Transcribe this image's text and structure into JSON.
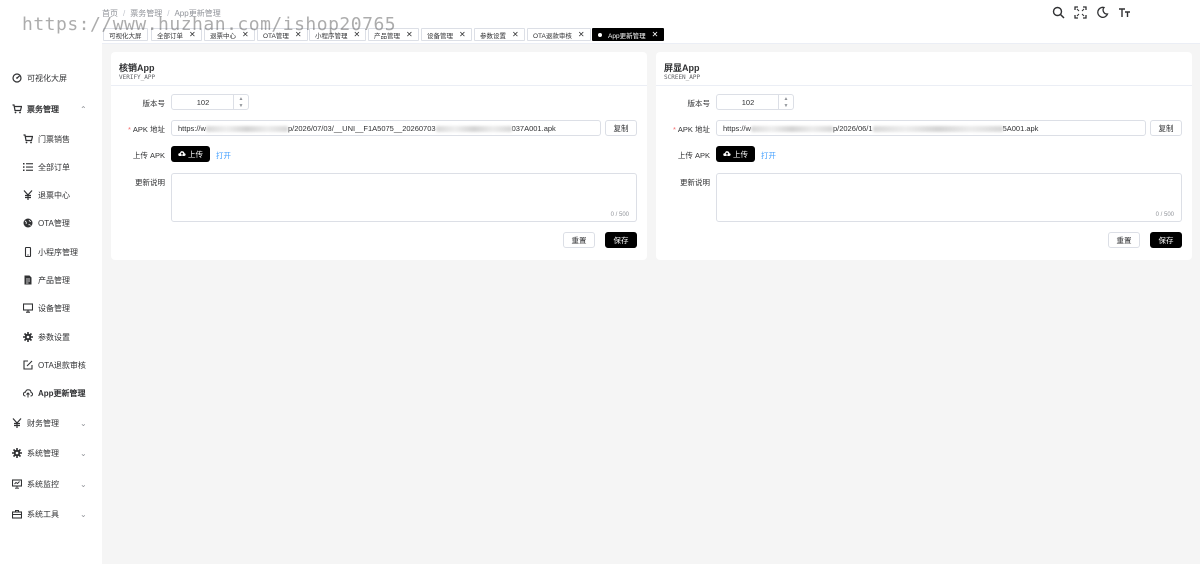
{
  "watermark": "https://www.huzhan.com/ishop20765",
  "breadcrumb": [
    "首页",
    "票务管理",
    "App更新管理"
  ],
  "header_icons": [
    "search-icon",
    "fullscreen-icon",
    "dark-mode-icon",
    "font-size-icon"
  ],
  "sidebar": {
    "items": [
      {
        "label": "可视化大屏",
        "icon": "dashboard-icon"
      },
      {
        "label": "票务管理",
        "icon": "cart-icon",
        "chevron": "⌃"
      },
      {
        "label": "门票销售",
        "icon": "cart-icon"
      },
      {
        "label": "全部订单",
        "icon": "list-icon"
      },
      {
        "label": "退票中心",
        "icon": "yen-icon"
      },
      {
        "label": "OTA管理",
        "icon": "globe-icon"
      },
      {
        "label": "小程序管理",
        "icon": "mobile-icon"
      },
      {
        "label": "产品管理",
        "icon": "document-icon"
      },
      {
        "label": "设备管理",
        "icon": "monitor-icon"
      },
      {
        "label": "参数设置",
        "icon": "gear-icon"
      },
      {
        "label": "OTA退款审核",
        "icon": "edit-icon"
      },
      {
        "label": "App更新管理",
        "icon": "cloud-upload-icon"
      },
      {
        "label": "财务管理",
        "icon": "yen-icon",
        "chevron": "⌄"
      },
      {
        "label": "系统管理",
        "icon": "gear-icon",
        "chevron": "⌄"
      },
      {
        "label": "系统监控",
        "icon": "monitor-icon",
        "chevron": "⌄"
      },
      {
        "label": "系统工具",
        "icon": "toolbox-icon",
        "chevron": "⌄"
      }
    ]
  },
  "tabs": [
    {
      "label": "可视化大屏",
      "close": ""
    },
    {
      "label": "全部订单",
      "close": "✕"
    },
    {
      "label": "退票中心",
      "close": "✕"
    },
    {
      "label": "OTA管理",
      "close": "✕"
    },
    {
      "label": "小程序管理",
      "close": "✕"
    },
    {
      "label": "产品管理",
      "close": "✕"
    },
    {
      "label": "设备管理",
      "close": "✕"
    },
    {
      "label": "参数设置",
      "close": "✕"
    },
    {
      "label": "OTA退款审核",
      "close": "✕"
    },
    {
      "label": "App更新管理",
      "close": "✕"
    }
  ],
  "cards": [
    {
      "title": "核销App",
      "code": "VERIFY_APP",
      "version_label": "版本号",
      "version": "102",
      "apk_label": "APK 地址",
      "required_mark": "*",
      "apk_url_start": "https://w",
      "apk_url_mid": "p/2026/07/03/__UNI__F1A5075__20260703",
      "apk_url_end": "037A001.apk",
      "copy_label": "复制",
      "upload_label": "上传 APK",
      "upload_btn": "上传",
      "open_link": "打开",
      "notes_label": "更新说明",
      "notes_count": "0 / 500",
      "reset_label": "重置",
      "save_label": "保存"
    },
    {
      "title": "屏显App",
      "code": "SCREEN_APP",
      "version_label": "版本号",
      "version": "102",
      "apk_label": "APK 地址",
      "required_mark": "*",
      "apk_url_start": "https://w",
      "apk_url_mid": "p/2026/06/1",
      "apk_url_end": "5A001.apk",
      "copy_label": "复制",
      "upload_label": "上传 APK",
      "upload_btn": "上传",
      "open_link": "打开",
      "notes_label": "更新说明",
      "notes_count": "0 / 500",
      "reset_label": "重置",
      "save_label": "保存"
    }
  ]
}
